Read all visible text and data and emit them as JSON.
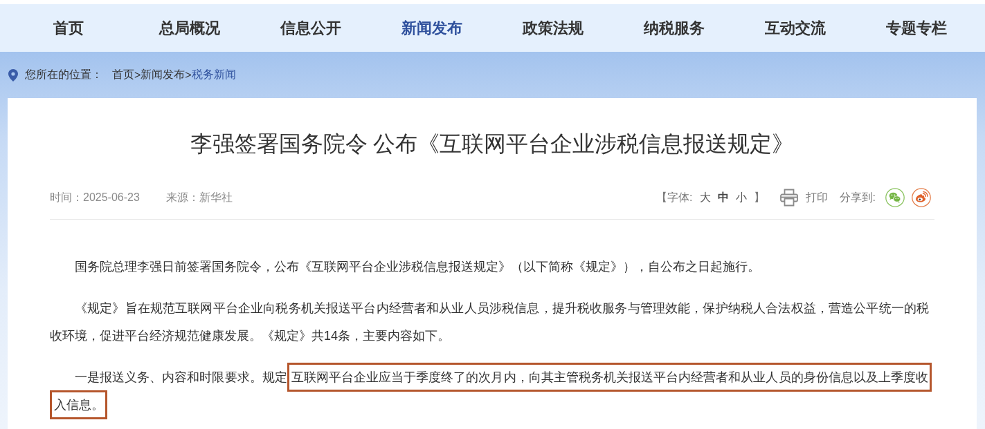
{
  "nav": {
    "items": [
      {
        "label": "首页",
        "selected": false
      },
      {
        "label": "总局概况",
        "selected": false
      },
      {
        "label": "信息公开",
        "selected": false
      },
      {
        "label": "新闻发布",
        "selected": true
      },
      {
        "label": "政策法规",
        "selected": false
      },
      {
        "label": "纳税服务",
        "selected": false
      },
      {
        "label": "互动交流",
        "selected": false
      },
      {
        "label": "专题专栏",
        "selected": false
      }
    ]
  },
  "breadcrumb": {
    "label": "您所在的位置：",
    "items": [
      {
        "label": "首页",
        "separator": ">",
        "selected": false
      },
      {
        "label": "新闻发布",
        "separator": ">",
        "selected": false
      },
      {
        "label": "税务新闻",
        "selected": true
      }
    ]
  },
  "article": {
    "title": "李强签署国务院令 公布《互联网平台企业涉税信息报送规定》",
    "meta": {
      "time": "时间：2025-06-23",
      "source": "来源：新华社"
    },
    "tools": {
      "font_size_label": "【字体:",
      "font_sizes": [
        {
          "label": "大",
          "selected": false
        },
        {
          "label": "中",
          "selected": true
        },
        {
          "label": "小",
          "selected": false
        }
      ],
      "font_size_close": "】",
      "print_label": "打印",
      "share_label": "分享到:"
    },
    "paragraphs": [
      {
        "segments": [
          {
            "text": "国务院总理李强日前签署国务院令，公布《互联网平台企业涉税信息报送规定》（以下简称《规定》），自公布之日起施行。",
            "highlighted": false
          }
        ]
      },
      {
        "segments": [
          {
            "text": "《规定》旨在规范互联网平台企业向税务机关报送平台内经营者和从业人员涉税信息，提升税收服务与管理效能，保护纳税人合法权益，营造公平统一的税收环境，促进平台经济规范健康发展。《规定》共14条，主要内容如下。",
            "highlighted": false
          }
        ]
      },
      {
        "segments": [
          {
            "text": "一是报送义务、内容和时限要求。规定",
            "highlighted": false
          },
          {
            "text": "互联网平台企业应当于季度终了的次月内，向其主管税务机关报送平台内经营者和从业人员的身份信息以及上季度收入信息。",
            "highlighted": true
          }
        ]
      }
    ]
  }
}
